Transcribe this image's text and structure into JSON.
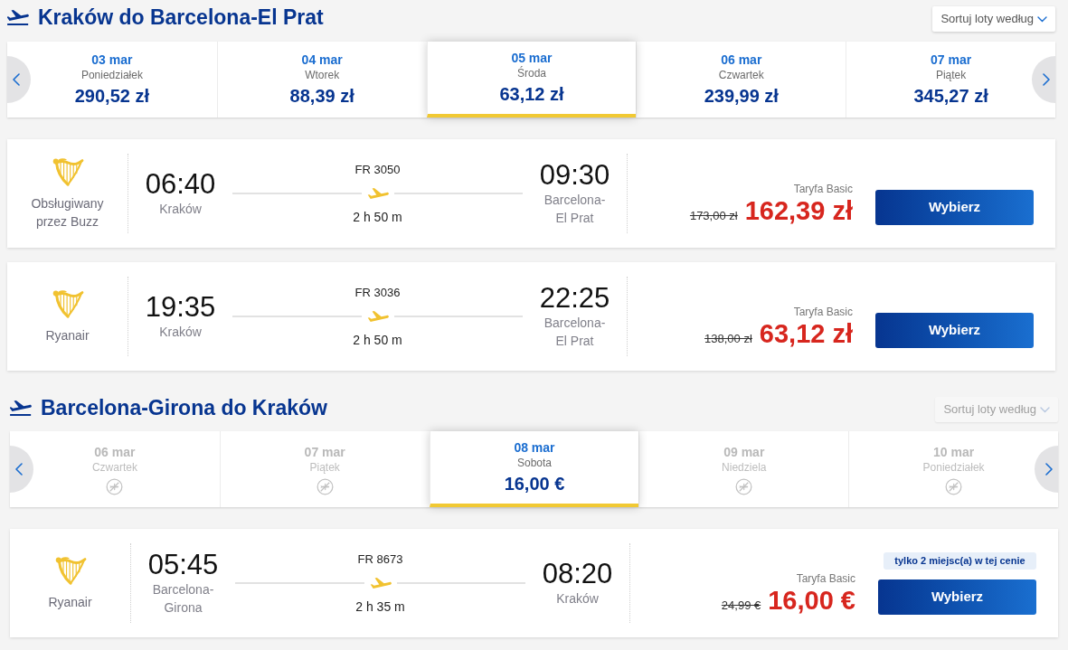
{
  "sections": [
    {
      "title": "Kraków do Barcelona-El Prat",
      "sort": {
        "label": "Sortuj loty według",
        "disabled": false
      },
      "dates": [
        {
          "date": "03 mar",
          "day": "Poniedziałek",
          "price": "290,52 zł",
          "selected": false,
          "available": true
        },
        {
          "date": "04 mar",
          "day": "Wtorek",
          "price": "88,39 zł",
          "selected": false,
          "available": true
        },
        {
          "date": "05 mar",
          "day": "Środa",
          "price": "63,12 zł",
          "selected": true,
          "available": true
        },
        {
          "date": "06 mar",
          "day": "Czwartek",
          "price": "239,99 zł",
          "selected": false,
          "available": true
        },
        {
          "date": "07 mar",
          "day": "Piątek",
          "price": "345,27 zł",
          "selected": false,
          "available": true
        }
      ],
      "flights": [
        {
          "airline": "Obsługiwany przez Buzz",
          "departure_time": "06:40",
          "departure_city": "Kraków",
          "flight_number": "FR 3050",
          "duration": "2 h 50 m",
          "arrival_time": "09:30",
          "arrival_city": "Barcelona-El Prat",
          "fare": "Taryfa Basic",
          "old_price": "173,00 zł",
          "price": "162,39 zł",
          "button": "Wybierz"
        },
        {
          "airline": "Ryanair",
          "departure_time": "19:35",
          "departure_city": "Kraków",
          "flight_number": "FR 3036",
          "duration": "2 h 50 m",
          "arrival_time": "22:25",
          "arrival_city": "Barcelona-El Prat",
          "fare": "Taryfa Basic",
          "old_price": "138,00 zł",
          "price": "63,12 zł",
          "button": "Wybierz"
        }
      ]
    },
    {
      "title": "Barcelona-Girona do Kraków",
      "sort": {
        "label": "Sortuj loty według",
        "disabled": true
      },
      "dates": [
        {
          "date": "06 mar",
          "day": "Czwartek",
          "selected": false,
          "available": false
        },
        {
          "date": "07 mar",
          "day": "Piątek",
          "selected": false,
          "available": false
        },
        {
          "date": "08 mar",
          "day": "Sobota",
          "price": "16,00 €",
          "selected": true,
          "available": true
        },
        {
          "date": "09 mar",
          "day": "Niedziela",
          "selected": false,
          "available": false
        },
        {
          "date": "10 mar",
          "day": "Poniedziałek",
          "selected": false,
          "available": false
        }
      ],
      "flights": [
        {
          "airline": "Ryanair",
          "departure_time": "05:45",
          "departure_city": "Barcelona-Girona",
          "flight_number": "FR 8673",
          "duration": "2 h 35 m",
          "arrival_time": "08:20",
          "arrival_city": "Kraków",
          "fare": "Taryfa Basic",
          "old_price": "24,99 €",
          "price": "16,00 €",
          "badge": "tylko 2 miejsc(a) w tej cenie",
          "button": "Wybierz"
        }
      ]
    }
  ]
}
